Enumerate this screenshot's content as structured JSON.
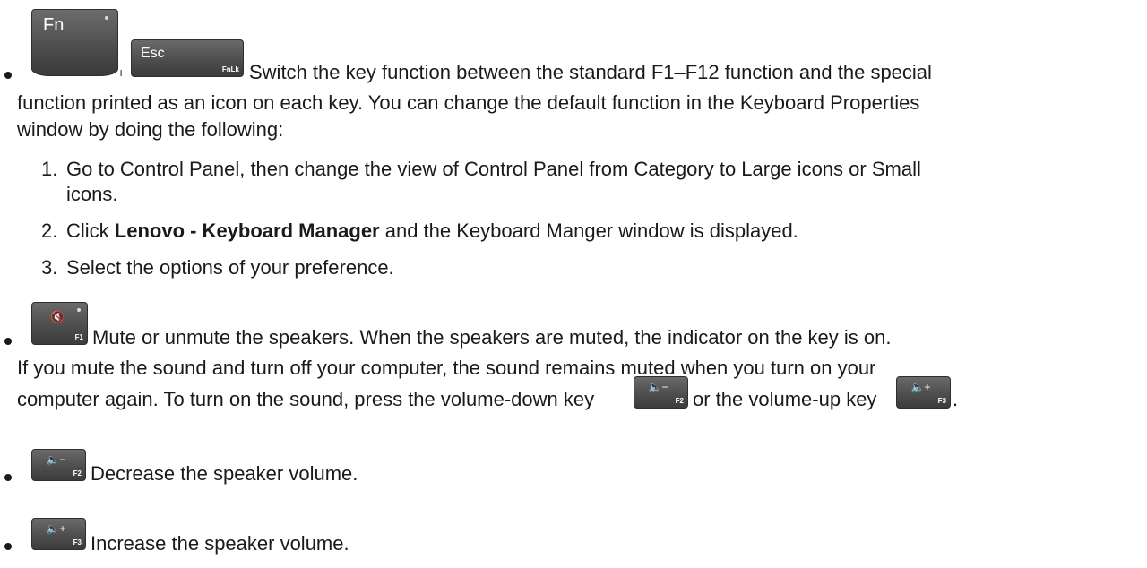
{
  "keys": {
    "fn": {
      "label": "Fn"
    },
    "plus": "+",
    "esc": {
      "label": "Esc",
      "sub": "FnLk"
    },
    "mute": {
      "icon": "speaker-mute-icon",
      "glyph": "🔇",
      "sub": "F1"
    },
    "vol_down": {
      "icon": "speaker-volume-down-icon",
      "glyph": "🔈−",
      "sub": "F2"
    },
    "vol_up": {
      "icon": "speaker-volume-up-icon",
      "glyph": "🔈+",
      "sub": "F3"
    }
  },
  "fnlock": {
    "line1": "Switch the key function between the standard F1–F12 function and the special",
    "line2": "function printed as an icon on each key. You can change the default function in the Keyboard Properties",
    "line3": "window by doing the following:",
    "steps": [
      {
        "num": "1.",
        "line1": "Go to Control Panel, then change the view of Control Panel from Category to Large icons or Small",
        "line2": "icons."
      },
      {
        "num": "2.",
        "pre": "Click ",
        "bold": "Lenovo - Keyboard Manager",
        "post": " and the Keyboard Manger window is displayed."
      },
      {
        "num": "3.",
        "text": "Select the options of your preference."
      }
    ]
  },
  "mute": {
    "line1": "Mute or unmute the speakers. When the speakers are muted, the indicator on the key is on.",
    "line2": "If you mute the sound and turn off your computer, the sound remains muted when you turn on your",
    "line3_pre": "computer again. To turn on the sound, press the volume-down key",
    "line3_mid": "or the volume-up key",
    "line3_end": "."
  },
  "volume_down": {
    "text": "Decrease the speaker volume."
  },
  "volume_up": {
    "text": "Increase the speaker volume."
  }
}
